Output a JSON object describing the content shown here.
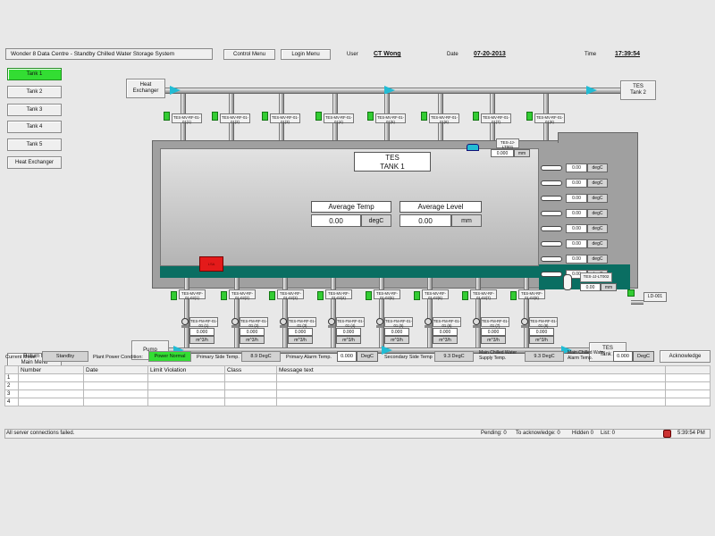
{
  "header": {
    "title": "Wonder 8 Data Centre - Standby Chilled Water Storage System",
    "control_menu": "Control Menu",
    "login_menu": "Login Menu",
    "user_label": "User",
    "user_value": "CT Wong",
    "date_label": "Date",
    "date_value": "07-20-2013",
    "time_label": "Time",
    "time_value": "17:39:54"
  },
  "sidebar": {
    "items": [
      {
        "label": "Tank 1",
        "active": true
      },
      {
        "label": "Tank 2"
      },
      {
        "label": "Tank 3"
      },
      {
        "label": "Tank 4"
      },
      {
        "label": "Tank 5"
      },
      {
        "label": "Heat Exchanger"
      }
    ],
    "return_label": "Return to Main Menu"
  },
  "diagram": {
    "heat_exchanger": "Heat Exchanger",
    "tes_tank2_top": "TES Tank 2",
    "tes_tank2_bottom": "TES Tank 2",
    "pump": "Pump",
    "tank_title_1": "TES",
    "tank_title_2": "TANK 1",
    "avg_temp_label": "Average Temp",
    "avg_temp_value": "0.00",
    "avg_temp_unit": "degC",
    "avg_level_label": "Average Level",
    "avg_level_value": "0.00",
    "avg_level_unit": "mm",
    "level_top_tag": "TES-JJ-LT001",
    "level_top_value": "0.000",
    "level_top_unit": "mm",
    "level_bottom_tag": "TES-JJ-LT002",
    "level_bottom_value": "0.00",
    "level_bottom_unit": "mm",
    "ld_tag": "LD-001",
    "alarm_box": "LSA",
    "top_valves": [
      {
        "tag": "TES-MV-RF-01-01(1)"
      },
      {
        "tag": "TES-MV-RF-01-01(2)"
      },
      {
        "tag": "TES-MV-RF-01-01(3)"
      },
      {
        "tag": "TES-MV-RF-01-01(4)"
      },
      {
        "tag": "TES-MV-RF-01-01(5)"
      },
      {
        "tag": "TES-MV-RF-01-01(6)"
      },
      {
        "tag": "TES-MV-RF-01-01(7)"
      },
      {
        "tag": "TES-MV-RF-01-01(8)"
      }
    ],
    "temps": [
      {
        "value": "0.00",
        "unit": "degC"
      },
      {
        "value": "0.00",
        "unit": "degC"
      },
      {
        "value": "0.00",
        "unit": "degC"
      },
      {
        "value": "0.00",
        "unit": "degC"
      },
      {
        "value": "0.00",
        "unit": "degC"
      },
      {
        "value": "0.00",
        "unit": "degC"
      },
      {
        "value": "0.00",
        "unit": "degC"
      },
      {
        "value": "0.00",
        "unit": "degC"
      }
    ],
    "bottom_valves": [
      {
        "tag": "TES-MV-RF-01-02(1)"
      },
      {
        "tag": "TES-MV-RF-01-02(2)"
      },
      {
        "tag": "TES-MV-RF-01-02(3)"
      },
      {
        "tag": "TES-MV-RF-01-02(4)"
      },
      {
        "tag": "TES-MV-RF-01-02(5)"
      },
      {
        "tag": "TES-MV-RF-01-02(6)"
      },
      {
        "tag": "TES-MV-RF-01-02(7)"
      },
      {
        "tag": "TES-MV-RF-01-02(8)"
      }
    ],
    "flowmeters": [
      {
        "tag": "TES-FM-RF-01-01 (1)",
        "value": "0.000",
        "unit": "m^3/h"
      },
      {
        "tag": "TES-FM-RF-01-01 (2)",
        "value": "0.000",
        "unit": "m^3/h"
      },
      {
        "tag": "TES-FM-RF-01-01 (3)",
        "value": "0.000",
        "unit": "m^3/h"
      },
      {
        "tag": "TES-FM-RF-01-01 (4)",
        "value": "0.000",
        "unit": "m^3/h"
      },
      {
        "tag": "TES-FM-RF-01-01 (5)",
        "value": "0.000",
        "unit": "m^3/h"
      },
      {
        "tag": "TES-FM-RF-01-01 (6)",
        "value": "0.000",
        "unit": "m^3/h"
      },
      {
        "tag": "TES-FM-RF-01-01 (7)",
        "value": "0.000",
        "unit": "m^3/h"
      },
      {
        "tag": "TES-FM-RF-01-01 (8)",
        "value": "0.000",
        "unit": "m^3/h"
      }
    ]
  },
  "status": {
    "current_mode_label": "Current Mode:",
    "current_mode_value": "Standby",
    "plant_power_label": "Plant Power Condition:",
    "plant_power_value": "Power Normal",
    "primary_side_temp_label": "Primary Side Temp.",
    "primary_side_temp_value": "8.9 DegC",
    "primary_alarm_label": "Primary Alarm Temp.",
    "primary_alarm_value": "0.000",
    "primary_alarm_unit": "DegC",
    "secondary_side_label": "Secondary Side Temp",
    "secondary_side_value": "9.3 DegC",
    "main_supply_label": "Main Chilled Water Supply Temp.",
    "main_supply_value": "9.3 DegC",
    "main_alarm_label": "Main Chilled Water Alarm Temp.",
    "main_alarm_value": "0.000",
    "main_alarm_unit": "DegC",
    "acknowledge": "Acknowledge"
  },
  "alarm_table": {
    "columns": [
      "Number",
      "Date",
      "Limit Violation",
      "Class",
      "Message text"
    ],
    "rows": [
      "1",
      "2",
      "3",
      "4"
    ]
  },
  "footer": {
    "message": "All server connections failed.",
    "pending": "Pending: 0",
    "to_ack": "To acknowledge: 0",
    "hidden": "Hidden 0",
    "list": "List: 0",
    "time": "5:39:54 PM"
  },
  "colors": {
    "accent_green": "#33dd33",
    "tank_teal": "#0a6e62",
    "flow_cyan": "#22bcd4"
  }
}
